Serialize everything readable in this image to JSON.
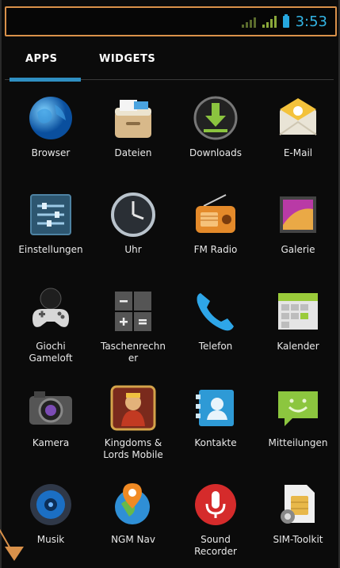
{
  "status": {
    "time": "3:53"
  },
  "tabs": {
    "apps": "APPS",
    "widgets": "WIDGETS"
  },
  "apps": [
    {
      "label": "Browser",
      "icon": "browser-globe-icon"
    },
    {
      "label": "Dateien",
      "icon": "files-icon"
    },
    {
      "label": "Downloads",
      "icon": "download-icon"
    },
    {
      "label": "E-Mail",
      "icon": "email-icon"
    },
    {
      "label": "Einstellungen",
      "icon": "settings-sliders-icon"
    },
    {
      "label": "Uhr",
      "icon": "clock-icon"
    },
    {
      "label": "FM Radio",
      "icon": "radio-icon"
    },
    {
      "label": "Galerie",
      "icon": "gallery-icon"
    },
    {
      "label": "Giochi\nGameloft",
      "icon": "gamepad-icon"
    },
    {
      "label": "Taschenrechn\ner",
      "icon": "calculator-icon"
    },
    {
      "label": "Telefon",
      "icon": "phone-icon"
    },
    {
      "label": "Kalender",
      "icon": "calendar-icon"
    },
    {
      "label": "Kamera",
      "icon": "camera-icon"
    },
    {
      "label": "Kingdoms &\nLords Mobile",
      "icon": "kingdoms-game-icon"
    },
    {
      "label": "Kontakte",
      "icon": "contacts-icon"
    },
    {
      "label": "Mitteilungen",
      "icon": "messaging-icon"
    },
    {
      "label": "Musik",
      "icon": "music-speaker-icon"
    },
    {
      "label": "NGM Nav",
      "icon": "navigation-icon"
    },
    {
      "label": "Sound\nRecorder",
      "icon": "microphone-icon"
    },
    {
      "label": "SIM-Toolkit",
      "icon": "sim-toolkit-icon"
    }
  ],
  "colors": {
    "accent": "#33b5e5",
    "highlight": "#d9914a",
    "background": "#0b0b0b"
  }
}
